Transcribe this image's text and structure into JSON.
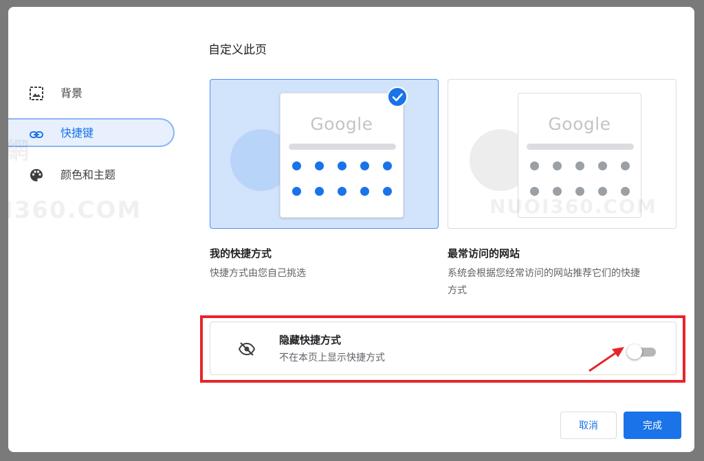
{
  "page": {
    "title": "自定义此页"
  },
  "sidebar": {
    "items": [
      {
        "label": "背景",
        "icon": "image-icon"
      },
      {
        "label": "快捷键",
        "icon": "link-icon",
        "active": true
      },
      {
        "label": "颜色和主题",
        "icon": "palette-icon"
      }
    ]
  },
  "options": [
    {
      "logo_text": "Google",
      "title": "我的快捷方式",
      "description": "快捷方式由您自己挑选",
      "selected": true
    },
    {
      "logo_text": "Google",
      "title": "最常访问的网站",
      "description_line1": "系统会根据您经常访问的网站推荐它们的快捷",
      "description_line2": "方式",
      "selected": false
    }
  ],
  "hide_shortcuts": {
    "title": "隐藏快捷方式",
    "description": "不在本页上显示快捷方式",
    "enabled": false
  },
  "buttons": {
    "cancel": "取消",
    "done": "完成"
  },
  "watermark": {
    "text1": "NUOI360.COM",
    "text2": "I360.COM"
  },
  "colors": {
    "accent": "#1a73e8",
    "annotation": "#e8242b",
    "selected_bg": "#d2e3fc"
  }
}
